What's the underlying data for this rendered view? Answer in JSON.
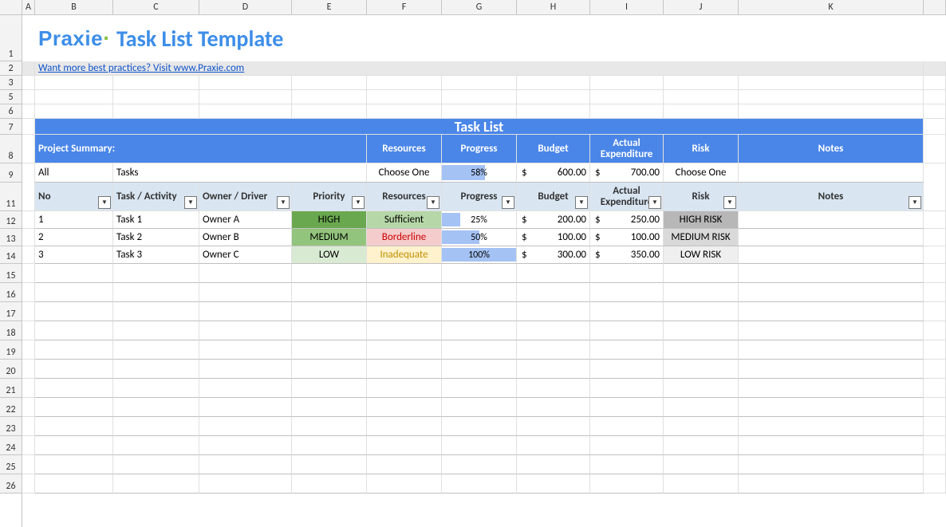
{
  "columns": [
    "A",
    "B",
    "C",
    "D",
    "E",
    "F",
    "G",
    "H",
    "I",
    "J",
    "K"
  ],
  "row_headers_visible": [
    "1",
    "2",
    "3",
    "5",
    "6",
    "7",
    "8",
    "9",
    "11",
    "12",
    "13",
    "14",
    "15",
    "16",
    "17",
    "18",
    "19",
    "20",
    "21",
    "22",
    "23",
    "24",
    "25",
    "26"
  ],
  "brand": {
    "name": "Praxie",
    "dot": "·"
  },
  "title": "Task List Template",
  "link_text": "Want more best practices? Visit www.Praxie.com",
  "section_title": "Task List",
  "subheader": {
    "label": "Project Summary:",
    "resources": "Resources",
    "progress": "Progress",
    "budget": "Budget",
    "actual": "Actual Expenditure",
    "risk": "Risk",
    "notes": "Notes"
  },
  "summary": {
    "all": "All",
    "tasks": "Tasks",
    "resources": "Choose One",
    "progress_pct": 58,
    "progress_text": "58%",
    "budget_sym": "$",
    "budget": "600.00",
    "actual_sym": "$",
    "actual": "700.00",
    "risk": "Choose One",
    "notes": ""
  },
  "table_headers": {
    "no": "No",
    "task": "Task / Activity",
    "owner": "Owner / Driver",
    "priority": "Priority",
    "resources": "Resources",
    "progress": "Progress",
    "budget": "Budget",
    "actual": "Actual Expenditure",
    "risk": "Risk",
    "notes": "Notes"
  },
  "rows": [
    {
      "no": "1",
      "task": "Task 1",
      "owner": "Owner A",
      "priority": "HIGH",
      "priority_class": "b-high",
      "resources": "Sufficient",
      "resources_class": "b-suff",
      "progress_pct": 25,
      "progress_text": "25%",
      "budget_sym": "$",
      "budget": "200.00",
      "actual_sym": "$",
      "actual": "250.00",
      "risk": "HIGH RISK",
      "risk_class": "r-high",
      "notes": ""
    },
    {
      "no": "2",
      "task": "Task 2",
      "owner": "Owner B",
      "priority": "MEDIUM",
      "priority_class": "b-med",
      "resources": "Borderline",
      "resources_class": "b-bord",
      "progress_pct": 50,
      "progress_text": "50%",
      "budget_sym": "$",
      "budget": "100.00",
      "actual_sym": "$",
      "actual": "100.00",
      "risk": "MEDIUM RISK",
      "risk_class": "r-med",
      "notes": ""
    },
    {
      "no": "3",
      "task": "Task 3",
      "owner": "Owner C",
      "priority": "LOW",
      "priority_class": "b-low",
      "resources": "Inadequate",
      "resources_class": "b-inad",
      "progress_pct": 100,
      "progress_text": "100%",
      "budget_sym": "$",
      "budget": "300.00",
      "actual_sym": "$",
      "actual": "350.00",
      "risk": "LOW RISK",
      "risk_class": "r-low",
      "notes": ""
    }
  ],
  "empty_rows": 12,
  "filter_glyph": "▼"
}
